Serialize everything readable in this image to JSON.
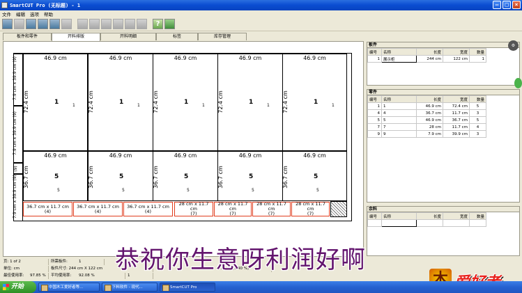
{
  "window": {
    "title": "SmartCUT Pro (无标题) - 1"
  },
  "menu": [
    "文件",
    "编辑",
    "选项",
    "帮助"
  ],
  "tabs": [
    {
      "label": "板件和零件",
      "active": false
    },
    {
      "label": "开料排版",
      "active": true
    },
    {
      "label": "开料明细",
      "active": false
    },
    {
      "label": "标签",
      "active": false
    },
    {
      "label": "库存管理",
      "active": false
    }
  ],
  "layout": {
    "top_pieces": {
      "width": "46.9 cm",
      "height": "72.4 cm",
      "id": "1",
      "small": "1"
    },
    "mid_pieces": {
      "width": "46.9 cm",
      "height": "36.7 cm",
      "id": "5",
      "small": "5"
    },
    "strip_top": "7.9 cm x 39.9 cm (9)",
    "strip_mid": "7.9 cm x 39.9 cm (9)",
    "strip_bottom": "7.9 cm x 39.9 cm (9)",
    "strip_mid2": "(9)",
    "bottom_a": "36.7 cm x 11.7 cm (4)",
    "bottom_b1": "28 cm x 11.7 cm",
    "bottom_b2": "(7)"
  },
  "sheets_panel": {
    "title": "板件",
    "headers": [
      "编号",
      "名称",
      "长度",
      "宽度",
      "数量"
    ],
    "rows": [
      {
        "no": "1",
        "name": "展示柜",
        "length": "244 cm",
        "width": "122 cm",
        "qty": "1"
      }
    ]
  },
  "parts_panel": {
    "title": "零件",
    "headers": [
      "编号",
      "名称",
      "长度",
      "宽度",
      "数量"
    ],
    "rows": [
      {
        "no": "1",
        "name": "1",
        "length": "46.9 cm",
        "width": "72.4 cm",
        "qty": "5"
      },
      {
        "no": "4",
        "name": "4",
        "length": "36.7 cm",
        "width": "11.7 cm",
        "qty": "3"
      },
      {
        "no": "5",
        "name": "5",
        "length": "46.9 cm",
        "width": "36.7 cm",
        "qty": "5"
      },
      {
        "no": "7",
        "name": "7",
        "length": "28 cm",
        "width": "11.7 cm",
        "qty": "4"
      },
      {
        "no": "9",
        "name": "9",
        "length": "7.9 cm",
        "width": "39.9 cm",
        "qty": "3"
      }
    ]
  },
  "remnant_panel": {
    "title": "余料",
    "headers": [
      "编号",
      "名称",
      "长度",
      "宽度",
      "数量"
    ]
  },
  "status": {
    "page": "页: 1 of 2",
    "needed_label": "所需板件:",
    "needed_value": "1",
    "unit": "单位: cm",
    "sheet_size": "板件尺寸: 244 cm X 122 cm",
    "best_label": "最佳使用率:",
    "best_value": "97.85 %",
    "avg_label": "平均使用率:",
    "avg_value": "92.08 %",
    "extra": "1",
    "coords": "0.3 cm (7.40 %)"
  },
  "overlay": {
    "text": "恭祝你生意呀利润好啊",
    "logo_mark": "木",
    "logo_text": "爱好者"
  },
  "taskbar": {
    "start": "开始",
    "tasks": [
      "中国木工爱好者等...",
      "下料软件 - 现代...",
      "SmartCUT Pro"
    ]
  },
  "colors": {
    "titlebar": "#0a4cd1",
    "overlay_text": "#63156e",
    "bottom_piece_border": "#e03d1e"
  }
}
